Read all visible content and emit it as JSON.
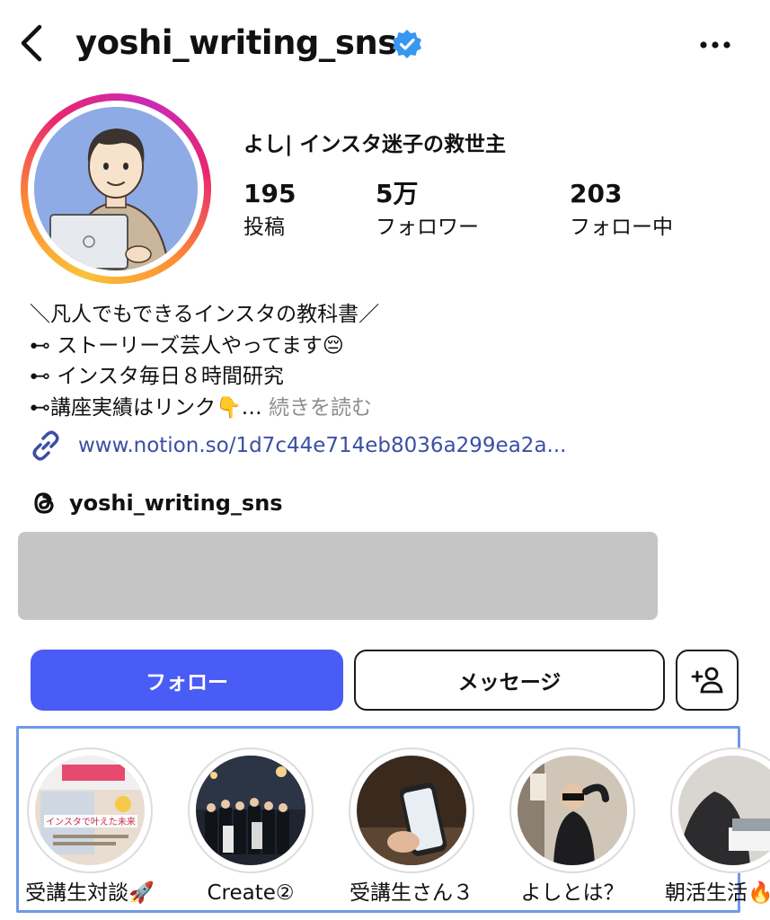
{
  "header": {
    "username": "yoshi_writing_sns",
    "verified_icon": "verified-badge-icon",
    "verified_color": "#3897f0"
  },
  "profile": {
    "display_name": "よし| インスタ迷子の救世主",
    "stats": [
      {
        "value": "195",
        "label": "投稿"
      },
      {
        "value": "5万",
        "label": "フォロワー"
      },
      {
        "value": "203",
        "label": "フォロー中"
      }
    ]
  },
  "bio": {
    "line1": "＼凡人でもできるインスタの教科書／",
    "line2": "⊷ ストーリーズ芸人やってます😔",
    "line3": "⊷ インスタ毎日８時間研究",
    "line4": "⊷講座実績はリンク👇…",
    "more": " 続きを読む",
    "link": "www.notion.so/1d7c44e714eb8036a299ea2a...",
    "threads": "yoshi_writing_sns"
  },
  "actions": {
    "follow": "フォロー",
    "message": "メッセージ",
    "follow_color": "#4a5cf6"
  },
  "highlights": [
    {
      "label": "受講生対談🚀",
      "thumb_text": "インスタで叶えた未来"
    },
    {
      "label": "Create②"
    },
    {
      "label": "受講生さん３"
    },
    {
      "label": "よしとは？"
    },
    {
      "label": "朝活生活🔥"
    }
  ]
}
